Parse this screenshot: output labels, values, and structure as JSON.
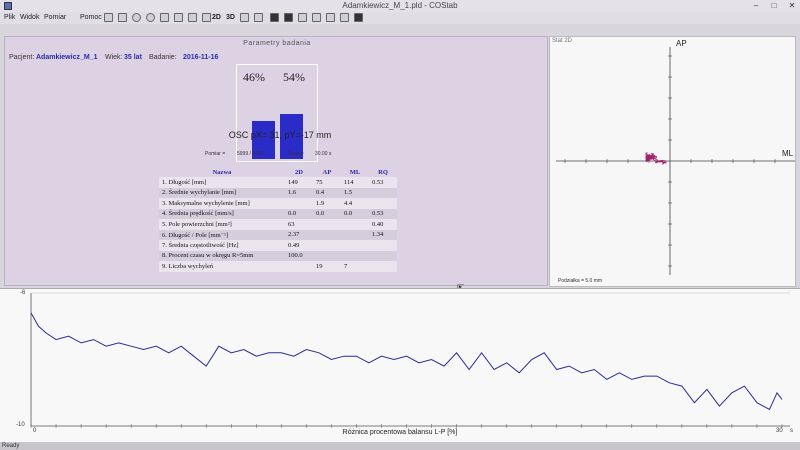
{
  "window": {
    "title": "Adamkiewicz_M_1.pld - COStab"
  },
  "menu": [
    "Plik",
    "Widok",
    "Pomiar",
    "Pomoc"
  ],
  "toolbar": {
    "label_2d": "2D",
    "label_3d": "3D"
  },
  "params": {
    "title": "Parametry badania",
    "patient_label": "Pacjent:",
    "patient": "Adamkiewicz_M_1",
    "age_label": "Wiek:",
    "age": "35 lat",
    "exam_label": "Badanie:",
    "exam_date": "2016-11-16",
    "left_pct": "46%",
    "right_pct": "54%",
    "left_fraction": 0.46,
    "right_fraction": 0.54,
    "osc": "OSC pX= 31, pY=-17 mm",
    "pomiar_label": "Pomiar =",
    "pomiar": "5999 / 6000",
    "czas_label": "Czas =",
    "czas": "30.00 s"
  },
  "table": {
    "headers": [
      "Nazwa",
      "2D",
      "AP",
      "ML",
      "RQ"
    ],
    "rows": [
      [
        "1. Długość [mm]",
        "149",
        "75",
        "114",
        "0.53"
      ],
      [
        "2. Średnie wychylanie [mm]",
        "1.6",
        "0.4",
        "1.5",
        ""
      ],
      [
        "3. Maksymalne wychylenie [mm]",
        "",
        "1.9",
        "4.4",
        ""
      ],
      [
        "4. Średnia prędkość [mm/s]",
        "0.0",
        "0.0",
        "0.0",
        "0.53"
      ],
      [
        "5. Pole powierzchni [mm²]",
        "63",
        "",
        "",
        "0.40"
      ],
      [
        "6. Długość / Pole [mm⁻¹]",
        "2.37",
        "",
        "",
        "1.34"
      ],
      [
        "7. Średnia częstotliwość [Hz]",
        "0.49",
        "",
        "",
        ""
      ],
      [
        "8. Procent czasu w okręgu R=5mm",
        "100.0",
        "",
        "",
        ""
      ],
      [
        "9. Liczba wychyleń",
        "",
        "19",
        "7",
        ""
      ]
    ]
  },
  "stat": {
    "label": "Stat 2D",
    "ap_label": "AP",
    "ml_label": "ML",
    "podzialka": "Podziałka = 5.0 mm",
    "trace_color": "#a0206a"
  },
  "balance": {
    "y_top": "-6",
    "y_bottom": "-10",
    "x_start": "0",
    "x_end": "30",
    "x_end_unit": "s",
    "xlabel": "Różnica procentowa balansu L-P [%]",
    "line_color": "#2a2a9a",
    "chart_data": {
      "type": "line",
      "xlabel": "",
      "ylabel": "",
      "xlim": [
        0,
        30
      ],
      "ylim": [
        -10,
        -6
      ],
      "x": [
        0,
        0.3,
        0.6,
        1,
        1.5,
        2,
        2.5,
        3,
        3.5,
        4,
        4.5,
        5,
        5.5,
        6,
        6.5,
        7,
        7.5,
        8,
        8.5,
        9,
        9.5,
        10,
        10.5,
        11,
        11.5,
        12,
        12.5,
        13,
        13.5,
        14,
        14.5,
        15,
        15.5,
        16,
        16.5,
        17,
        17.5,
        18,
        18.5,
        19,
        19.5,
        20,
        20.5,
        21,
        21.5,
        22,
        22.5,
        23,
        23.5,
        24,
        24.5,
        25,
        25.5,
        26,
        26.5,
        27,
        27.5,
        28,
        28.5,
        29,
        29.5,
        29.8,
        30
      ],
      "y": [
        -6.6,
        -7.0,
        -7.2,
        -7.4,
        -7.3,
        -7.5,
        -7.4,
        -7.6,
        -7.5,
        -7.6,
        -7.7,
        -7.6,
        -7.8,
        -7.6,
        -7.9,
        -8.2,
        -7.6,
        -7.8,
        -7.7,
        -7.9,
        -7.8,
        -7.8,
        -7.9,
        -7.7,
        -7.8,
        -8.0,
        -7.9,
        -7.9,
        -8.1,
        -7.9,
        -8.0,
        -7.9,
        -8.1,
        -8.0,
        -8.2,
        -7.8,
        -8.3,
        -7.8,
        -8.3,
        -8.1,
        -8.4,
        -8.0,
        -7.8,
        -8.3,
        -8.2,
        -8.4,
        -8.3,
        -8.6,
        -8.4,
        -8.6,
        -8.5,
        -8.5,
        -8.7,
        -8.8,
        -9.3,
        -8.9,
        -9.4,
        -9.0,
        -8.8,
        -9.3,
        -9.5,
        -9.0,
        -9.2
      ]
    }
  }
}
